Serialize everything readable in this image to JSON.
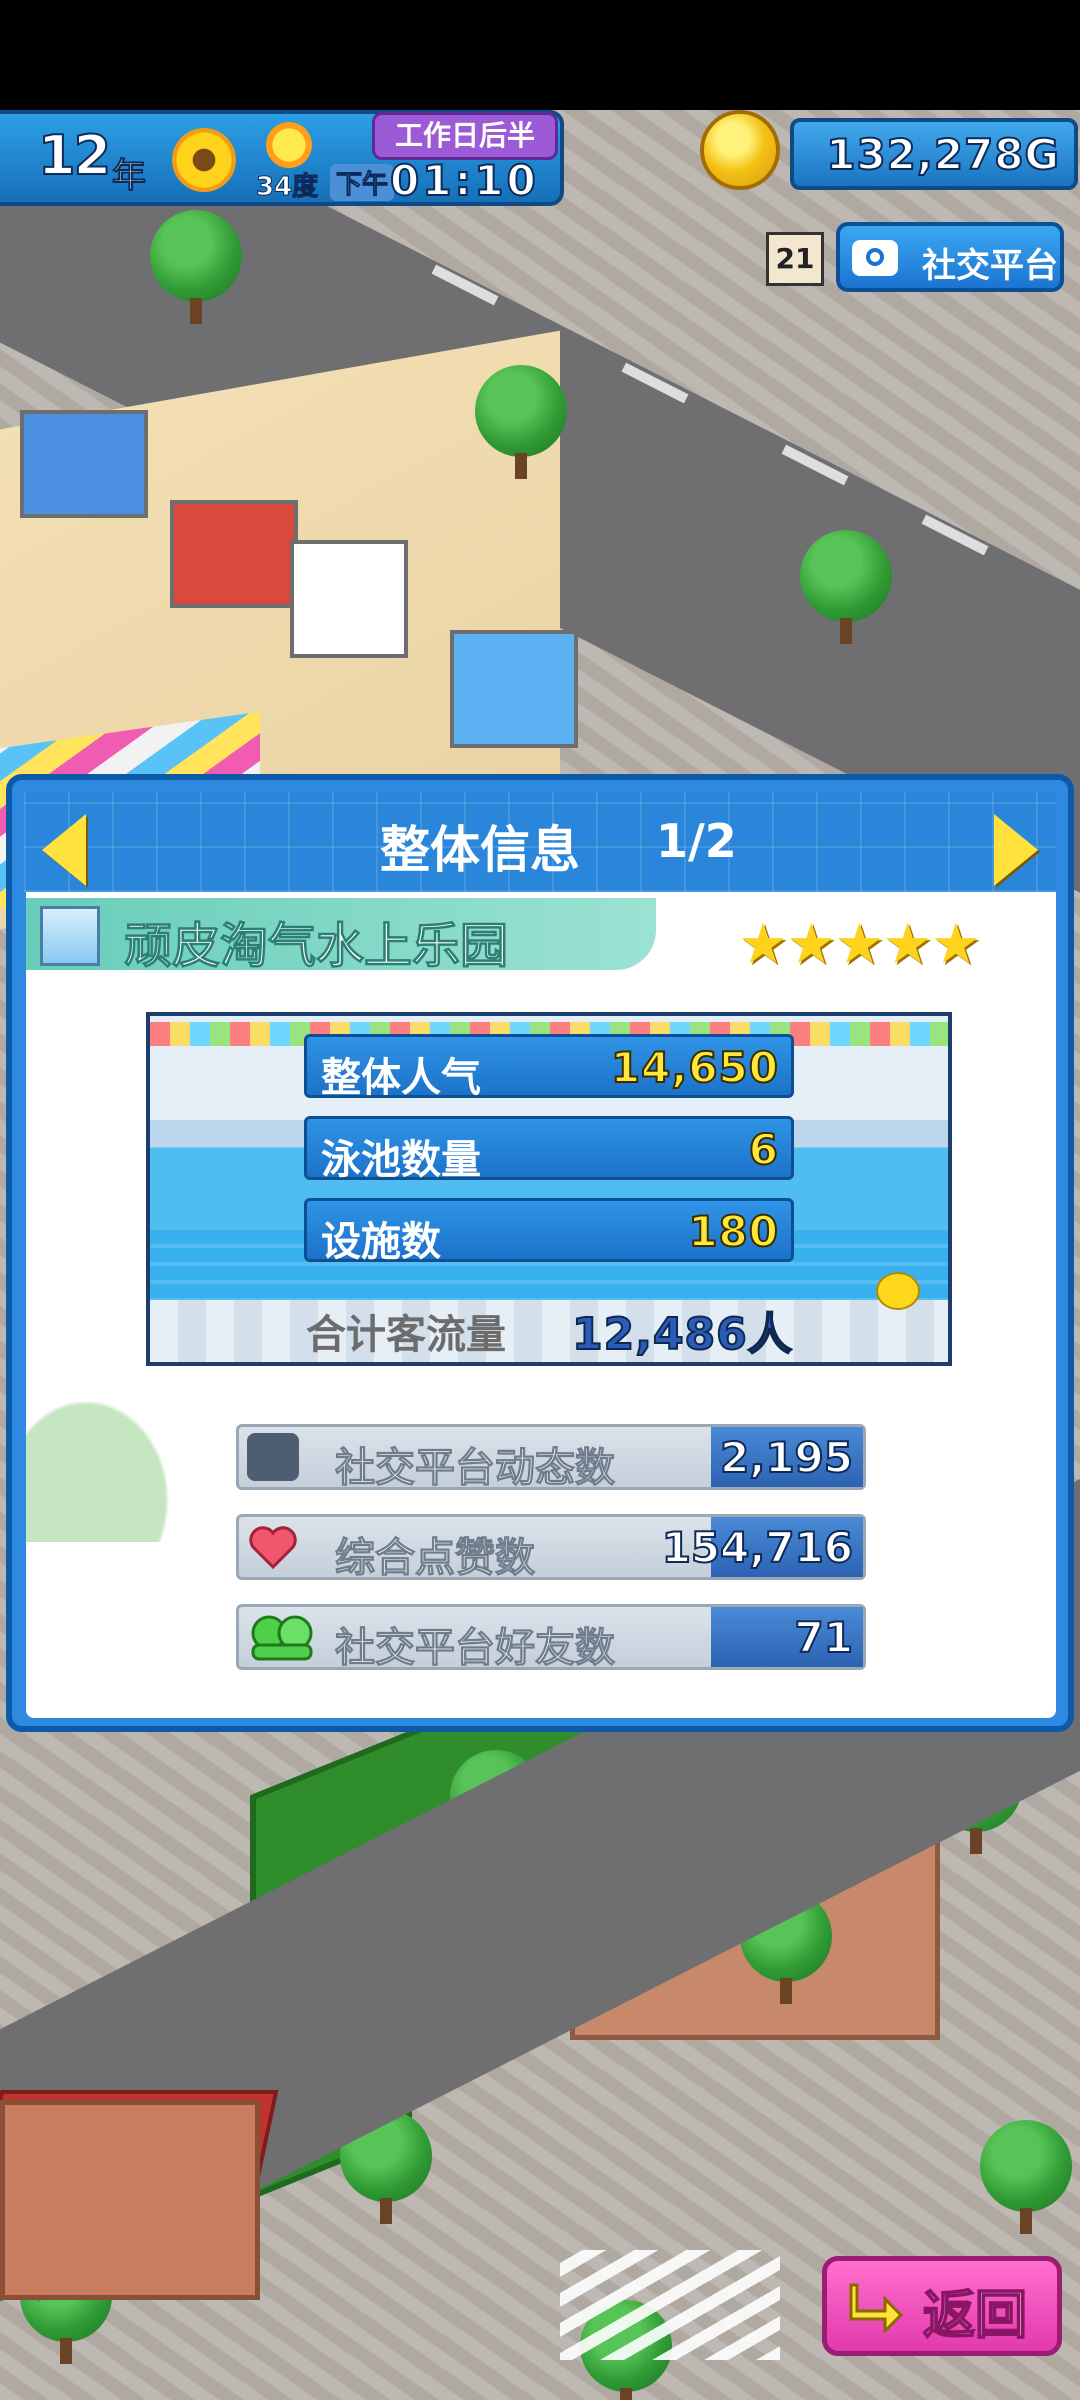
{
  "hud": {
    "year": "12",
    "year_unit": "年",
    "temperature": "34度",
    "period": "工作日后半",
    "ampm": "下午",
    "time": "01:10",
    "money": "132,278G"
  },
  "social": {
    "badge_count": "21",
    "button_label": "社交平台"
  },
  "panel": {
    "title": "整体信息",
    "page": "1/2",
    "park_name": "顽皮淘气水上乐园",
    "stars": "★★★★★",
    "stats": [
      {
        "label": "整体人气",
        "value": "14,650"
      },
      {
        "label": "泳池数量",
        "value": "6"
      },
      {
        "label": "设施数",
        "value": "180"
      }
    ],
    "visitors_label": "合计客流量",
    "visitors_value": "12,486人",
    "social_stats": [
      {
        "label": "社交平台动态数",
        "value": "2,195"
      },
      {
        "label": "综合点赞数",
        "value": "154,716"
      },
      {
        "label": "社交平台好友数",
        "value": "71"
      }
    ]
  },
  "back_button": {
    "label": "返回"
  },
  "colors": {
    "panel_blue": "#2d8ae0",
    "value_yellow": "#ffe83a",
    "back_pink": "#e23aac",
    "teal_banner": "#67cdb9"
  }
}
